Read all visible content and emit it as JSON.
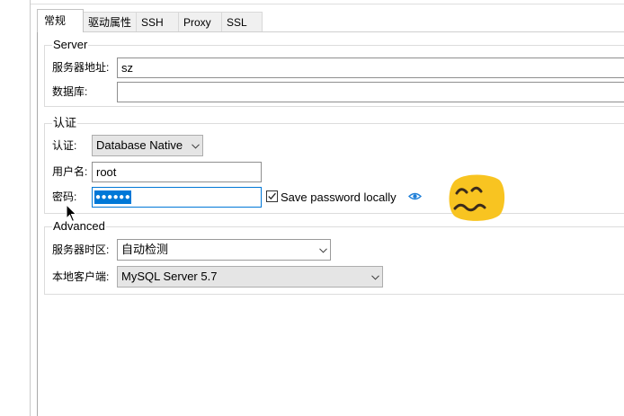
{
  "tabs": [
    {
      "label": "常规",
      "active": true
    },
    {
      "label": "驱动属性",
      "active": false
    },
    {
      "label": "SSH",
      "active": false
    },
    {
      "label": "Proxy",
      "active": false
    },
    {
      "label": "SSL",
      "active": false
    }
  ],
  "server": {
    "legend": "Server",
    "host": {
      "label": "服务器地址:",
      "value": "sz"
    },
    "database": {
      "label": "数据库:",
      "value": ""
    }
  },
  "auth": {
    "legend": "认证",
    "method": {
      "label": "认证:",
      "value": "Database Native"
    },
    "username": {
      "label": "用户名:",
      "value": "root"
    },
    "password": {
      "label": "密码:",
      "value": "●●●●●●",
      "selected": true
    },
    "save_password": {
      "label": "Save password locally",
      "checked": true
    }
  },
  "advanced": {
    "legend": "Advanced",
    "timezone": {
      "label": "服务器时区:",
      "value": "自动检测"
    },
    "client": {
      "label": "本地客户端:",
      "value": "MySQL Server 5.7"
    }
  },
  "icons": {
    "dropdown": "chevron-down-icon",
    "show_password": "eye-icon",
    "checkbox": "checkmark-icon",
    "emoji": "confounded-face-emoji",
    "cursor": "mouse-cursor-icon"
  },
  "colors": {
    "accent": "#0078d7",
    "eye_icon": "#1e7fd8",
    "emoji_yellow": "#f8c421",
    "group_border": "#dcdcdc"
  }
}
